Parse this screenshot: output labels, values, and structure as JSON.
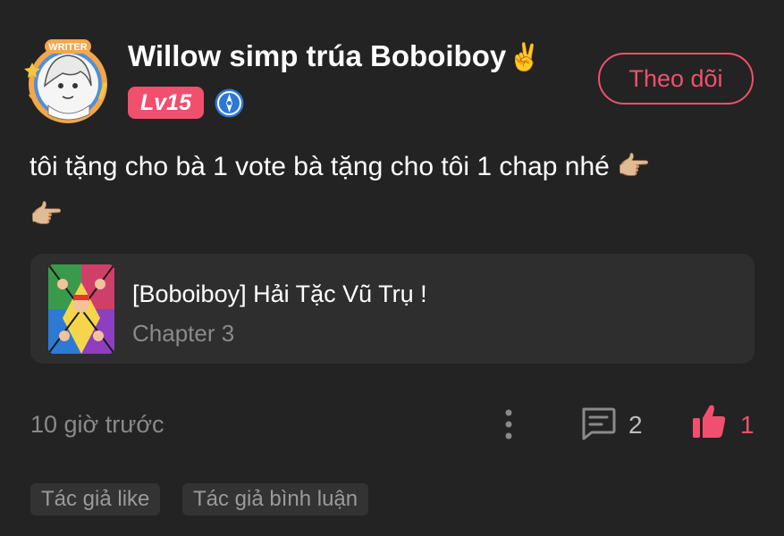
{
  "user": {
    "name": "Willow simp trúa Boboiboy",
    "name_emoji": "✌️",
    "level": "Lv15",
    "avatar_badge_text": "WRITER",
    "verify_icon": "compass-badge-icon"
  },
  "follow_button": {
    "label": "Theo dõi"
  },
  "comment": {
    "text": "tôi tặng cho bà 1 vote bà tặng cho tôi 1 chap nhé ",
    "emoji_1": "👉🏼",
    "emoji_2": "👉🏼"
  },
  "story": {
    "title": "[Boboiboy] Hải Tặc Vũ Trụ !",
    "chapter": "Chapter 3"
  },
  "meta": {
    "timestamp": "10 giờ trước",
    "comment_count": "2",
    "like_count": "1"
  },
  "tags": [
    "Tác giả like",
    "Tác giả bình luận"
  ],
  "colors": {
    "accent": "#f0506e",
    "background": "#232323",
    "card": "#2e2e2e",
    "muted": "#8a8a8a"
  }
}
